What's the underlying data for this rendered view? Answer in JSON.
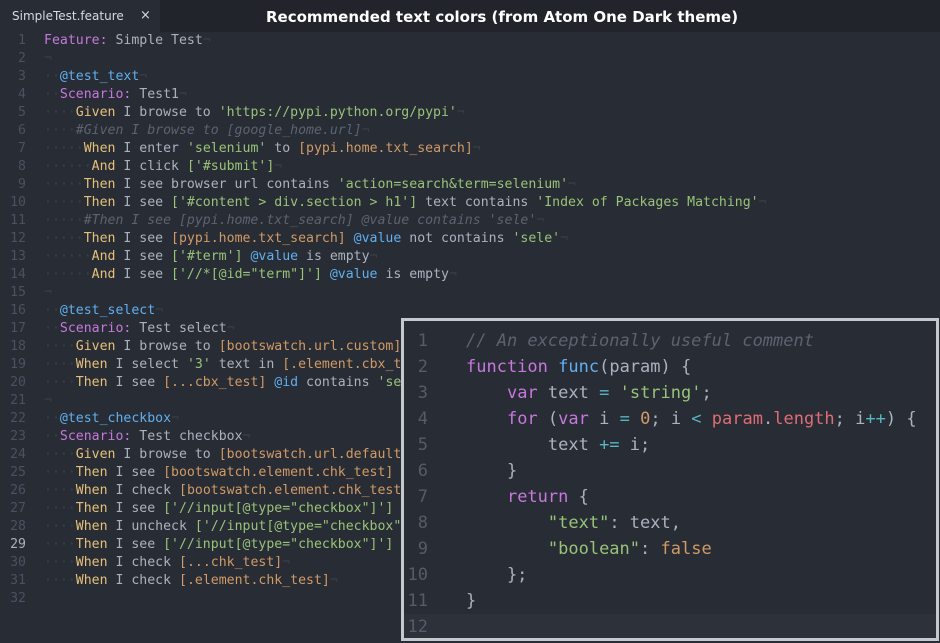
{
  "tab": {
    "label": "SimpleTest.feature",
    "close_glyph": "×"
  },
  "header_title": "Recommended text colors (from Atom One Dark theme)",
  "colors": {
    "keyword": "#c678dd",
    "string": "#98c379",
    "tag": "#61afef",
    "variable": "#e5c07b",
    "number": "#d19a66",
    "comment": "#5c6370",
    "property": "#e06c75",
    "operator": "#56b6c2",
    "background": "#282c34"
  },
  "editor": {
    "current_line": 29,
    "lines": [
      {
        "n": "1",
        "t": [
          [
            "kw",
            "Feature:"
          ],
          [
            "plain",
            " Simple Test"
          ],
          [
            "ws",
            "¬"
          ]
        ]
      },
      {
        "n": "2",
        "t": [
          [
            "ws",
            "¬"
          ]
        ]
      },
      {
        "n": "3",
        "t": [
          [
            "ws",
            "··"
          ],
          [
            "tag",
            "@test_text"
          ],
          [
            "ws",
            "¬"
          ]
        ]
      },
      {
        "n": "4",
        "t": [
          [
            "ws",
            "··"
          ],
          [
            "kw",
            "Scenario:"
          ],
          [
            "plain",
            " Test1"
          ],
          [
            "ws",
            "¬"
          ]
        ]
      },
      {
        "n": "5",
        "t": [
          [
            "ws",
            "····"
          ],
          [
            "var",
            "Given"
          ],
          [
            "plain",
            " I browse to "
          ],
          [
            "str",
            "'https://pypi.python.org/pypi'"
          ],
          [
            "ws",
            "¬"
          ]
        ]
      },
      {
        "n": "6",
        "t": [
          [
            "ws",
            "····"
          ],
          [
            "cmt",
            "#Given I browse to [google_home.url]"
          ],
          [
            "ws",
            "¬"
          ]
        ]
      },
      {
        "n": "7",
        "t": [
          [
            "ws",
            "·····"
          ],
          [
            "var",
            "When"
          ],
          [
            "plain",
            " I enter "
          ],
          [
            "str",
            "'selenium'"
          ],
          [
            "plain",
            " to "
          ],
          [
            "num",
            "[pypi.home.txt_search]"
          ],
          [
            "ws",
            "¬"
          ]
        ]
      },
      {
        "n": "8",
        "t": [
          [
            "ws",
            "······"
          ],
          [
            "var",
            "And"
          ],
          [
            "plain",
            " I click "
          ],
          [
            "str",
            "['#submit']"
          ],
          [
            "ws",
            "¬"
          ]
        ]
      },
      {
        "n": "9",
        "t": [
          [
            "ws",
            "·····"
          ],
          [
            "var",
            "Then"
          ],
          [
            "plain",
            " I see browser url contains "
          ],
          [
            "str",
            "'action=search&term=selenium'"
          ],
          [
            "ws",
            "¬"
          ]
        ]
      },
      {
        "n": "10",
        "t": [
          [
            "ws",
            "·····"
          ],
          [
            "var",
            "Then"
          ],
          [
            "plain",
            " I see "
          ],
          [
            "str",
            "['#content > div.section > h1']"
          ],
          [
            "plain",
            " text contains "
          ],
          [
            "str",
            "'Index of Packages Matching'"
          ],
          [
            "ws",
            "¬"
          ]
        ]
      },
      {
        "n": "11",
        "t": [
          [
            "ws",
            "·····"
          ],
          [
            "cmt",
            "#Then I see [pypi.home.txt_search] @value contains 'sele'"
          ],
          [
            "ws",
            "¬"
          ]
        ]
      },
      {
        "n": "12",
        "t": [
          [
            "ws",
            "·····"
          ],
          [
            "var",
            "Then"
          ],
          [
            "plain",
            " I see "
          ],
          [
            "num",
            "[pypi.home.txt_search]"
          ],
          [
            "plain",
            " "
          ],
          [
            "tag",
            "@value"
          ],
          [
            "plain",
            " not contains "
          ],
          [
            "str",
            "'sele'"
          ],
          [
            "ws",
            "¬"
          ]
        ]
      },
      {
        "n": "13",
        "t": [
          [
            "ws",
            "······"
          ],
          [
            "var",
            "And"
          ],
          [
            "plain",
            " I see "
          ],
          [
            "str",
            "['#term']"
          ],
          [
            "plain",
            " "
          ],
          [
            "tag",
            "@value"
          ],
          [
            "plain",
            " is empty"
          ],
          [
            "ws",
            "¬"
          ]
        ]
      },
      {
        "n": "14",
        "t": [
          [
            "ws",
            "······"
          ],
          [
            "var",
            "And"
          ],
          [
            "plain",
            " I see "
          ],
          [
            "str",
            "['//*[@id=\"term\"]']"
          ],
          [
            "plain",
            " "
          ],
          [
            "tag",
            "@value"
          ],
          [
            "plain",
            " is empty"
          ],
          [
            "ws",
            "¬"
          ]
        ]
      },
      {
        "n": "15",
        "t": [
          [
            "ws",
            "¬"
          ]
        ]
      },
      {
        "n": "16",
        "t": [
          [
            "ws",
            "··"
          ],
          [
            "tag",
            "@test_select"
          ],
          [
            "ws",
            "¬"
          ]
        ]
      },
      {
        "n": "17",
        "t": [
          [
            "ws",
            "··"
          ],
          [
            "kw",
            "Scenario:"
          ],
          [
            "plain",
            " Test select"
          ],
          [
            "ws",
            "¬"
          ]
        ]
      },
      {
        "n": "18",
        "t": [
          [
            "ws",
            "····"
          ],
          [
            "var",
            "Given"
          ],
          [
            "plain",
            " I browse to "
          ],
          [
            "num",
            "[bootswatch.url.custom]"
          ]
        ]
      },
      {
        "n": "19",
        "t": [
          [
            "ws",
            "····"
          ],
          [
            "var",
            "When"
          ],
          [
            "plain",
            " I select "
          ],
          [
            "str",
            "'3'"
          ],
          [
            "plain",
            " text in "
          ],
          [
            "num",
            "[.element.cbx_t"
          ]
        ]
      },
      {
        "n": "20",
        "t": [
          [
            "ws",
            "····"
          ],
          [
            "var",
            "Then"
          ],
          [
            "plain",
            " I see "
          ],
          [
            "num",
            "[...cbx_test]"
          ],
          [
            "plain",
            " "
          ],
          [
            "tag",
            "@id"
          ],
          [
            "plain",
            " contains "
          ],
          [
            "str",
            "'se"
          ]
        ]
      },
      {
        "n": "21",
        "t": [
          [
            "ws",
            "¬"
          ]
        ]
      },
      {
        "n": "22",
        "t": [
          [
            "ws",
            "··"
          ],
          [
            "tag",
            "@test_checkbox"
          ],
          [
            "ws",
            "¬"
          ]
        ]
      },
      {
        "n": "23",
        "t": [
          [
            "ws",
            "··"
          ],
          [
            "kw",
            "Scenario:"
          ],
          [
            "plain",
            " Test checkbox"
          ],
          [
            "ws",
            "¬"
          ]
        ]
      },
      {
        "n": "24",
        "t": [
          [
            "ws",
            "····"
          ],
          [
            "var",
            "Given"
          ],
          [
            "plain",
            " I browse to "
          ],
          [
            "num",
            "[bootswatch.url.default"
          ]
        ]
      },
      {
        "n": "25",
        "t": [
          [
            "ws",
            "····"
          ],
          [
            "var",
            "Then"
          ],
          [
            "plain",
            " I see "
          ],
          [
            "num",
            "[bootswatch.element.chk_test]"
          ]
        ]
      },
      {
        "n": "26",
        "t": [
          [
            "ws",
            "····"
          ],
          [
            "var",
            "When"
          ],
          [
            "plain",
            " I check "
          ],
          [
            "num",
            "[bootswatch.element.chk_test"
          ]
        ]
      },
      {
        "n": "27",
        "t": [
          [
            "ws",
            "····"
          ],
          [
            "var",
            "Then"
          ],
          [
            "plain",
            " I see "
          ],
          [
            "str",
            "['//input[@type=\"checkbox\"]']"
          ]
        ]
      },
      {
        "n": "28",
        "t": [
          [
            "ws",
            "····"
          ],
          [
            "var",
            "When"
          ],
          [
            "plain",
            " I uncheck "
          ],
          [
            "str",
            "['//input[@type=\"checkbox\"'"
          ]
        ]
      },
      {
        "n": "29",
        "t": [
          [
            "ws",
            "····"
          ],
          [
            "var",
            "Then"
          ],
          [
            "plain",
            " I see "
          ],
          [
            "str",
            "['//input[@type=\"checkbox\"]']"
          ]
        ]
      },
      {
        "n": "30",
        "t": [
          [
            "ws",
            "····"
          ],
          [
            "var",
            "When"
          ],
          [
            "plain",
            " I check "
          ],
          [
            "num",
            "[...chk_test]"
          ],
          [
            "ws",
            "¬"
          ]
        ]
      },
      {
        "n": "31",
        "t": [
          [
            "ws",
            "····"
          ],
          [
            "var",
            "When"
          ],
          [
            "plain",
            " I check "
          ],
          [
            "num",
            "[.element.chk_test]"
          ],
          [
            "ws",
            "¬"
          ]
        ]
      },
      {
        "n": "32",
        "t": []
      }
    ]
  },
  "overlay": {
    "current_line": 12,
    "lines": [
      {
        "n": "1",
        "t": [
          [
            "cmt",
            "// An exceptionally useful comment"
          ]
        ]
      },
      {
        "n": "2",
        "t": [
          [
            "kw",
            "function"
          ],
          [
            "plain",
            " "
          ],
          [
            "fn",
            "func"
          ],
          [
            "plain",
            "(param) {"
          ]
        ]
      },
      {
        "n": "3",
        "t": [
          [
            "plain",
            "    "
          ],
          [
            "kw",
            "var"
          ],
          [
            "plain",
            " text "
          ],
          [
            "op",
            "="
          ],
          [
            "plain",
            " "
          ],
          [
            "str",
            "'string'"
          ],
          [
            "plain",
            ";"
          ]
        ]
      },
      {
        "n": "4",
        "t": [
          [
            "plain",
            "    "
          ],
          [
            "kw",
            "for"
          ],
          [
            "plain",
            " ("
          ],
          [
            "kw",
            "var"
          ],
          [
            "plain",
            " i "
          ],
          [
            "op",
            "="
          ],
          [
            "plain",
            " "
          ],
          [
            "num",
            "0"
          ],
          [
            "plain",
            "; i "
          ],
          [
            "op",
            "<"
          ],
          [
            "plain",
            " "
          ],
          [
            "prop",
            "param"
          ],
          [
            "plain",
            "."
          ],
          [
            "prop",
            "length"
          ],
          [
            "plain",
            "; i"
          ],
          [
            "op",
            "++"
          ],
          [
            "plain",
            ") {"
          ]
        ]
      },
      {
        "n": "5",
        "t": [
          [
            "plain",
            "        text "
          ],
          [
            "op",
            "+="
          ],
          [
            "plain",
            " i;"
          ]
        ]
      },
      {
        "n": "6",
        "t": [
          [
            "plain",
            "    }"
          ]
        ]
      },
      {
        "n": "7",
        "t": [
          [
            "plain",
            "    "
          ],
          [
            "kw",
            "return"
          ],
          [
            "plain",
            " {"
          ]
        ]
      },
      {
        "n": "8",
        "t": [
          [
            "plain",
            "        "
          ],
          [
            "str",
            "\"text\""
          ],
          [
            "plain",
            ": text,"
          ]
        ]
      },
      {
        "n": "9",
        "t": [
          [
            "plain",
            "        "
          ],
          [
            "str",
            "\"boolean\""
          ],
          [
            "plain",
            ": "
          ],
          [
            "num",
            "false"
          ]
        ]
      },
      {
        "n": "10",
        "t": [
          [
            "plain",
            "    };"
          ]
        ]
      },
      {
        "n": "11",
        "t": [
          [
            "plain",
            "}"
          ]
        ]
      },
      {
        "n": "12",
        "t": []
      }
    ]
  }
}
